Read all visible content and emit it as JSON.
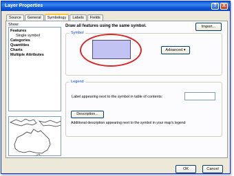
{
  "window": {
    "title": "Layer Properties",
    "help_glyph": "?",
    "close_glyph": "X"
  },
  "tabs": [
    {
      "label": "Source",
      "active": false
    },
    {
      "label": "General",
      "active": false
    },
    {
      "label": "Symbology",
      "active": true
    },
    {
      "label": "Labels",
      "active": false
    },
    {
      "label": "Fields",
      "active": false
    }
  ],
  "show": {
    "label": "Show:",
    "items": [
      {
        "label": "Features",
        "level": 0
      },
      {
        "label": "Single symbol",
        "level": 1
      },
      {
        "label": "Categories",
        "level": 0
      },
      {
        "label": "Quantities",
        "level": 0
      },
      {
        "label": "Charts",
        "level": 0
      },
      {
        "label": "Multiple Attributes",
        "level": 0
      }
    ]
  },
  "main": {
    "heading": "Draw all features using the same symbol.",
    "import_label": "Import...",
    "symbol_group_title": "Symbol",
    "symbol_fill": "#c3c3f3",
    "advanced_label": "Advanced",
    "advanced_arrow": "▾",
    "legend_group_title": "Legend",
    "legend_label": "Label appearing next to the symbol in table of contents:",
    "legend_value": "",
    "description_button": "Description...",
    "description_text": "Additional description appearing next to the symbol in your map's legend"
  },
  "footer": {
    "ok_label": "OK",
    "cancel_label": "Cancel"
  },
  "colors": {
    "title_bar": "#0a5bd8",
    "callout": "#d62828",
    "group_title": "#0046d5"
  }
}
